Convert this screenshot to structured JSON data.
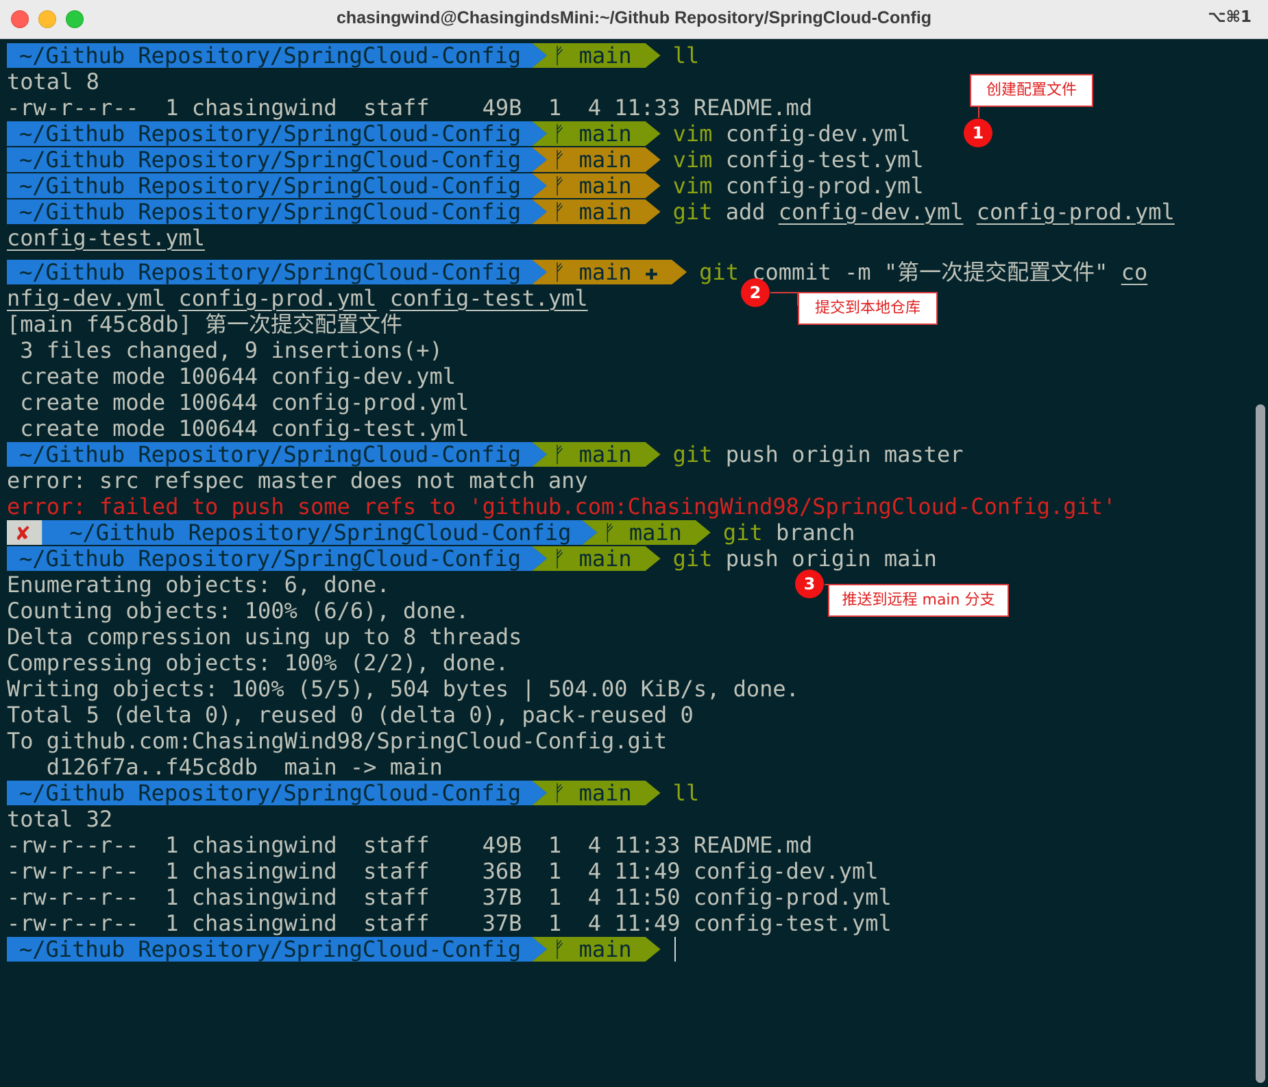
{
  "window": {
    "title": "chasingwind@ChasingindsMini:~/Github Repository/SpringCloud-Config",
    "shortcut": "⌥⌘1"
  },
  "prompt": {
    "path": "~/Github Repository/SpringCloud-Config",
    "branch_icon": "ᚠ",
    "branch": "main",
    "staged_marker": "✚",
    "error_marker": "✘"
  },
  "lines": {
    "l01": {
      "cmd": "ll",
      "args": ""
    },
    "l02": "total 8",
    "l03": "-rw-r--r--  1 chasingwind  staff    49B  1  4 11:33 README.md",
    "l04": {
      "cmd": "vim",
      "args": " config-dev.yml"
    },
    "l05": {
      "cmd": "vim",
      "args": " config-test.yml"
    },
    "l06": {
      "cmd": "vim",
      "args": " config-prod.yml"
    },
    "l07": {
      "cmd": "git",
      "args": " add ",
      "u1": "config-dev.yml",
      "u2": "config-prod.yml"
    },
    "l08": {
      "u1": "config-test.yml"
    },
    "l09": {
      "cmd": "git",
      "args": " commit -m \"第一次提交配置文件\" ",
      "u1": "co"
    },
    "l10": {
      "u1": "nfig-dev.yml",
      "u2": "config-prod.yml",
      "u3": "config-test.yml"
    },
    "l11": "[main f45c8db] 第一次提交配置文件",
    "l12": " 3 files changed, 9 insertions(+)",
    "l13": " create mode 100644 config-dev.yml",
    "l14": " create mode 100644 config-prod.yml",
    "l15": " create mode 100644 config-test.yml",
    "l16": {
      "cmd": "git",
      "args": " push origin master"
    },
    "l17": "error: src refspec master does not match any",
    "l18": "error: failed to push some refs to 'github.com:ChasingWind98/SpringCloud-Config.git'",
    "l19": {
      "cmd": "git",
      "args": " branch"
    },
    "l20": {
      "cmd": "git",
      "args": " push origin main"
    },
    "l21": "Enumerating objects: 6, done.",
    "l22": "Counting objects: 100% (6/6), done.",
    "l23": "Delta compression using up to 8 threads",
    "l24": "Compressing objects: 100% (2/2), done.",
    "l25": "Writing objects: 100% (5/5), 504 bytes | 504.00 KiB/s, done.",
    "l26": "Total 5 (delta 0), reused 0 (delta 0), pack-reused 0",
    "l27": "To github.com:ChasingWind98/SpringCloud-Config.git",
    "l28": "   d126f7a..f45c8db  main -> main",
    "l29": {
      "cmd": "ll",
      "args": ""
    },
    "l30": "total 32",
    "l31": "-rw-r--r--  1 chasingwind  staff    49B  1  4 11:33 README.md",
    "l32": "-rw-r--r--  1 chasingwind  staff    36B  1  4 11:49 config-dev.yml",
    "l33": "-rw-r--r--  1 chasingwind  staff    37B  1  4 11:50 config-prod.yml",
    "l34": "-rw-r--r--  1 chasingwind  staff    37B  1  4 11:49 config-test.yml"
  },
  "annotations": {
    "a1": {
      "number": "1",
      "label": "创建配置文件"
    },
    "a2": {
      "number": "2",
      "label": "提交到本地仓库"
    },
    "a3": {
      "number": "3",
      "label": "推送到远程 main 分支"
    }
  },
  "colors": {
    "background": "#05232b",
    "path_segment": "#1f7ad8",
    "branch_clean": "#7a9708",
    "branch_dirty": "#b5850a",
    "command": "#8fa512",
    "error_text": "#d7231e",
    "annotation": "#e02020"
  }
}
